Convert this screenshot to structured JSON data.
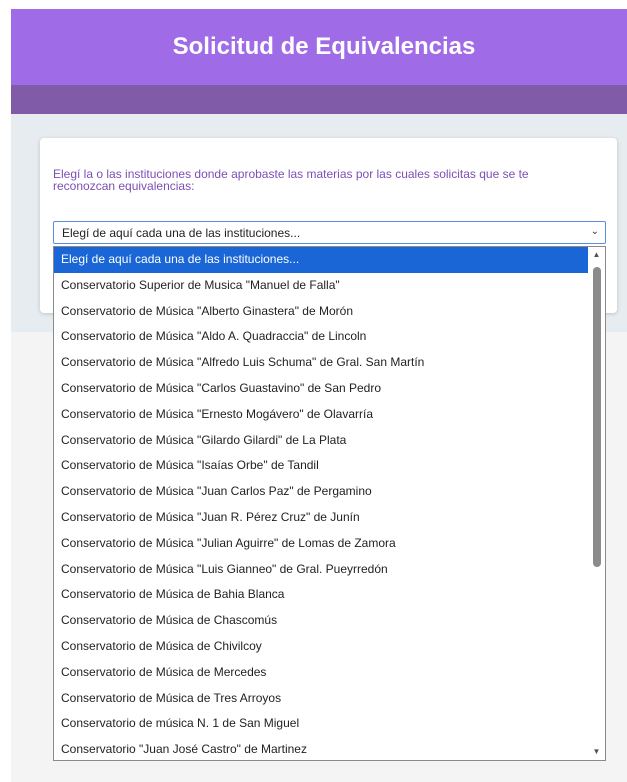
{
  "header": {
    "title": "Solicitud de Equivalencias"
  },
  "form": {
    "question": "Elegí la o las instituciones donde aprobaste las materias por las cuales solicitas que se te reconozcan equivalencias:",
    "select_value": "Elegí de aquí cada una de las instituciones...",
    "options": [
      "Elegí de aquí cada una de las instituciones...",
      "Conservatorio Superior de Musica \"Manuel de Falla\"",
      "Conservatorio de Música \"Alberto Ginastera\" de Morón",
      "Conservatorio de Música \"Aldo A. Quadraccia\" de Lincoln",
      "Conservatorio de Música \"Alfredo Luis Schuma\" de Gral. San Martín",
      "Conservatorio de Música \"Carlos Guastavino\" de San Pedro",
      "Conservatorio de Música \"Ernesto Mogávero\" de Olavarría",
      "Conservatorio de Música \"Gilardo Gilardi\" de La Plata",
      "Conservatorio de Música \"Isaías Orbe\" de Tandil",
      "Conservatorio de Música \"Juan Carlos Paz\" de Pergamino",
      "Conservatorio de Música \"Juan R. Pérez Cruz\" de Junín",
      "Conservatorio de Música \"Julian Aguirre\" de Lomas de Zamora",
      "Conservatorio de Música \"Luis Gianneo\" de Gral. Pueyrredón",
      "Conservatorio de Música de Bahia Blanca",
      "Conservatorio de Música de Chascomús",
      "Conservatorio de Música de Chivilcoy",
      "Conservatorio de Música de Mercedes",
      "Conservatorio de Música de Tres Arroyos",
      "Conservatorio de música N. 1 de San Miguel",
      "Conservatorio \"Juan José Castro\" de Martinez"
    ],
    "selected_index": 0
  },
  "icons": {
    "select_chevron": "chevron-down-icon",
    "scroll_up": "arrow-up-icon",
    "scroll_down": "arrow-down-icon"
  },
  "colors": {
    "header_bg": "#a06be6",
    "subbar_bg": "#805ca8",
    "question_text": "#7b4fb5",
    "selected_option_bg": "#1a66d6"
  }
}
